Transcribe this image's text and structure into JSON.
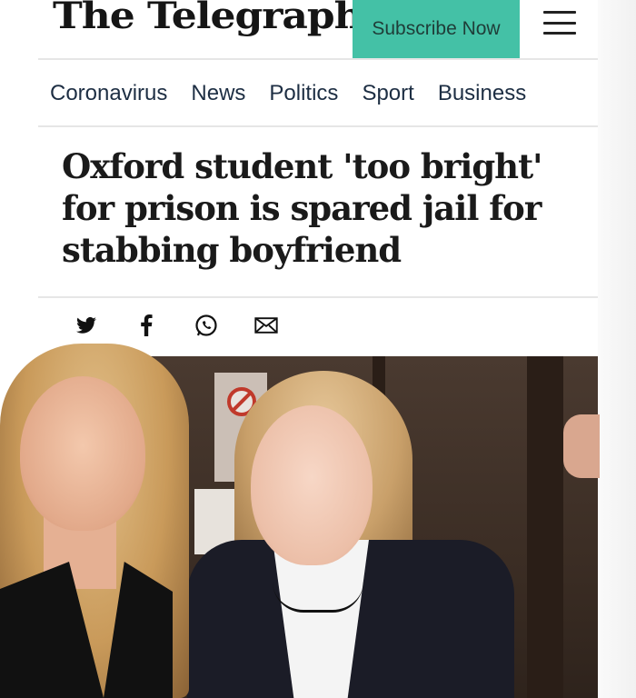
{
  "header": {
    "masthead": "The Telegraph",
    "subscribe_label": "Subscribe Now"
  },
  "nav": {
    "items": [
      "Coronavirus",
      "News",
      "Politics",
      "Sport",
      "Business"
    ]
  },
  "article": {
    "headline_lines": [
      "Oxford student 'too bright'",
      "for prison is spared jail for",
      "stabbing boyfriend"
    ]
  },
  "share": {
    "icons": [
      "twitter-icon",
      "facebook-icon",
      "whatsapp-icon",
      "email-icon"
    ]
  },
  "colors": {
    "subscribe_bg": "#44c1a6",
    "nav_text": "#1d2e43"
  }
}
